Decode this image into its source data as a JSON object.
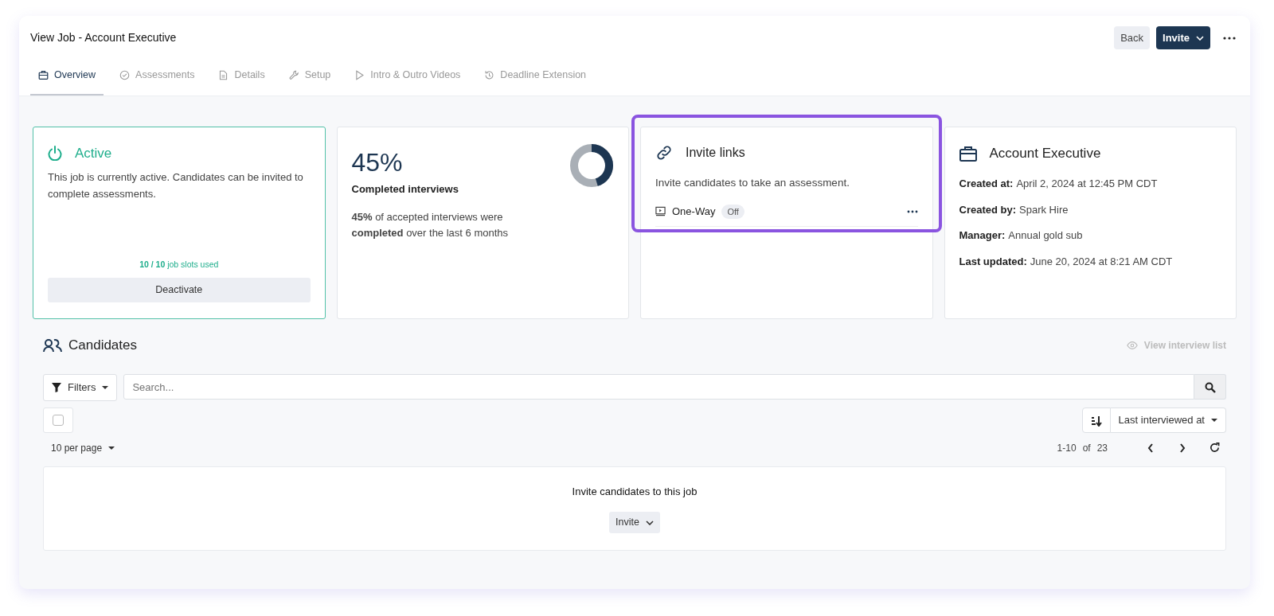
{
  "page": {
    "title": "View Job - Account Executive",
    "buttons": {
      "back": "Back",
      "invite": "Invite"
    }
  },
  "tabs": [
    {
      "label": "Overview",
      "selected": true
    },
    {
      "label": "Assessments",
      "selected": false
    },
    {
      "label": "Details",
      "selected": false
    },
    {
      "label": "Setup",
      "selected": false
    },
    {
      "label": "Intro & Outro Videos",
      "selected": false
    },
    {
      "label": "Deadline Extension",
      "selected": false
    }
  ],
  "status_card": {
    "title": "Active",
    "active": true,
    "text": "This job is currently active. Candidates can be invited to complete assessments.",
    "slots": "**10 / 10** job slots used",
    "button": "Deactivate"
  },
  "completion_card": {
    "value": "45%",
    "label": "Completed interviews",
    "level": 0.45,
    "text": "**45%** of accepted interviews were **completed** over the last 6 months"
  },
  "invite_links_card": {
    "title": "Invite links",
    "highlighted": true,
    "text": "Invite candidates to take an assessment.",
    "links": [
      {
        "label": "One-Way",
        "status": "Off",
        "on": false
      }
    ]
  },
  "job_card": {
    "title": "Account Executive",
    "fields": [
      {
        "label": "Created at:",
        "value": "April 2, 2024 at 12:45 PM CDT"
      },
      {
        "label": "Created by:",
        "value": "Spark Hire"
      },
      {
        "label": "Manager:",
        "value": "Annual gold sub"
      },
      {
        "label": "Last updated:",
        "value": "June 20, 2024 at 8:21 AM CDT"
      }
    ]
  },
  "candidates": {
    "title": "Candidates",
    "view_link": "View interview list",
    "filters": "Filters",
    "search": {
      "placeholder": "Search..."
    },
    "select_all": {
      "checked": false
    },
    "sort": "Last interviewed at",
    "per_page": "10 per page",
    "range": "1-10",
    "of": "of",
    "total": "23",
    "empty": {
      "text": "Invite candidates to this job",
      "button": "Invite"
    }
  }
}
